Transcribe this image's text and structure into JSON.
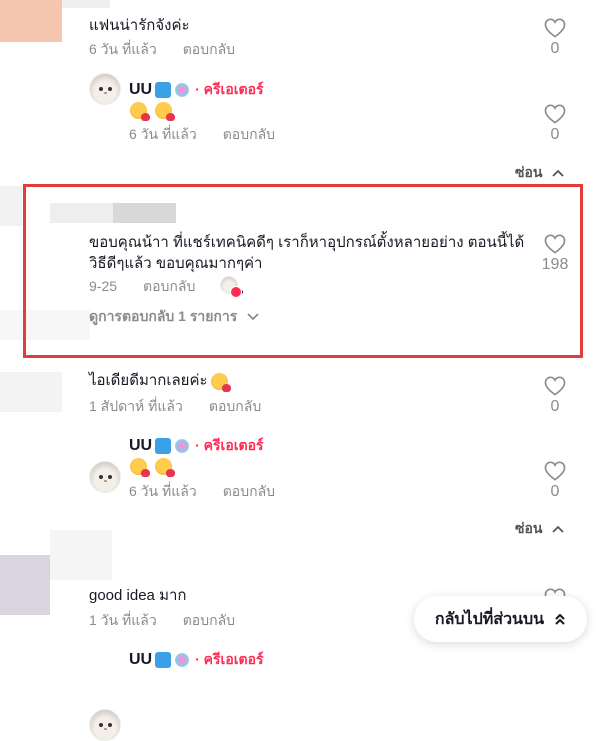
{
  "comments": [
    {
      "text": "แฟนน่ารักจังค่ะ",
      "time": "6 วัน ที่แล้ว",
      "reply_label": "ตอบกลับ",
      "likes": "0"
    },
    {
      "username": "UU",
      "creator_label": "· ครีเอเตอร์",
      "time": "6 วัน ที่แล้ว",
      "reply_label": "ตอบกลับ",
      "likes": "0"
    },
    {
      "text_line1": "ขอบคุณน้าา ที่แชร์เทคนิคดีๆ เราก็หาอุปกรณ์ตั้งหลายอย่าง ตอนนี้ได้",
      "text_line2": "วิธีดีๆแล้ว ขอบคุณมากๆค่า",
      "time": "9-25",
      "reply_label": "ตอบกลับ",
      "likes": "198",
      "view_replies": "ดูการตอบกลับ 1 รายการ"
    },
    {
      "text": "ไอเดียดีมากเลยค่ะ",
      "time": "1 สัปดาห์ ที่แล้ว",
      "reply_label": "ตอบกลับ",
      "likes": "0"
    },
    {
      "username": "UU",
      "creator_label": "· ครีเอเตอร์",
      "time": "6 วัน ที่แล้ว",
      "reply_label": "ตอบกลับ",
      "likes": "0"
    },
    {
      "text": "good idea มาก",
      "time": "1 วัน ที่แล้ว",
      "reply_label": "ตอบกลับ"
    },
    {
      "username": "UU",
      "creator_label": "· ครีเอเตอร์"
    }
  ],
  "hide_label": "ซ่อน",
  "back_to_top": "กลับไปที่ส่วนบน",
  "colors": {
    "creator": "#fe2c55",
    "highlight": "#e23c3c",
    "muted": "#8a8b91"
  }
}
